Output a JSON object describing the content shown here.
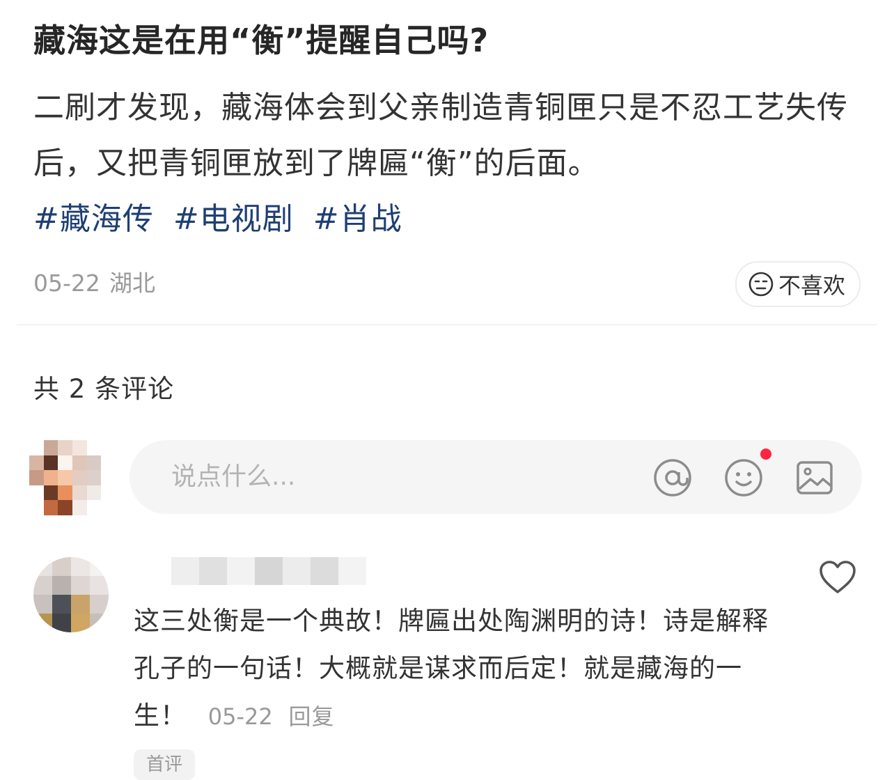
{
  "post": {
    "title": "藏海这是在用“衡”提醒自己吗?",
    "body": "二刷才发现，藏海体会到父亲制造青铜匣只是不忍工艺失传后，又把青铜匣放到了牌匾“衡”的后面。",
    "tags": [
      "#藏海传",
      "#电视剧",
      "#肖战"
    ],
    "date": "05-22",
    "location": "湖北",
    "dislike_label": "不喜欢"
  },
  "comments_header": "共 2 条评论",
  "composer": {
    "placeholder": "说点什么...",
    "icons": [
      "at-icon",
      "emoji-icon",
      "image-icon"
    ],
    "notify_dot_color": "#ff2442"
  },
  "comment": {
    "text": "这三处衡是一个典故！牌匾出处陶渊明的诗！诗是解释孔子的一句话！大概就是谋求而后定！就是藏海的一生！",
    "date": "05-22",
    "reply_label": "回复",
    "badge": "首评"
  },
  "colors": {
    "tag": "#1f3f73",
    "accent_red": "#ff2442",
    "muted": "#999999"
  }
}
